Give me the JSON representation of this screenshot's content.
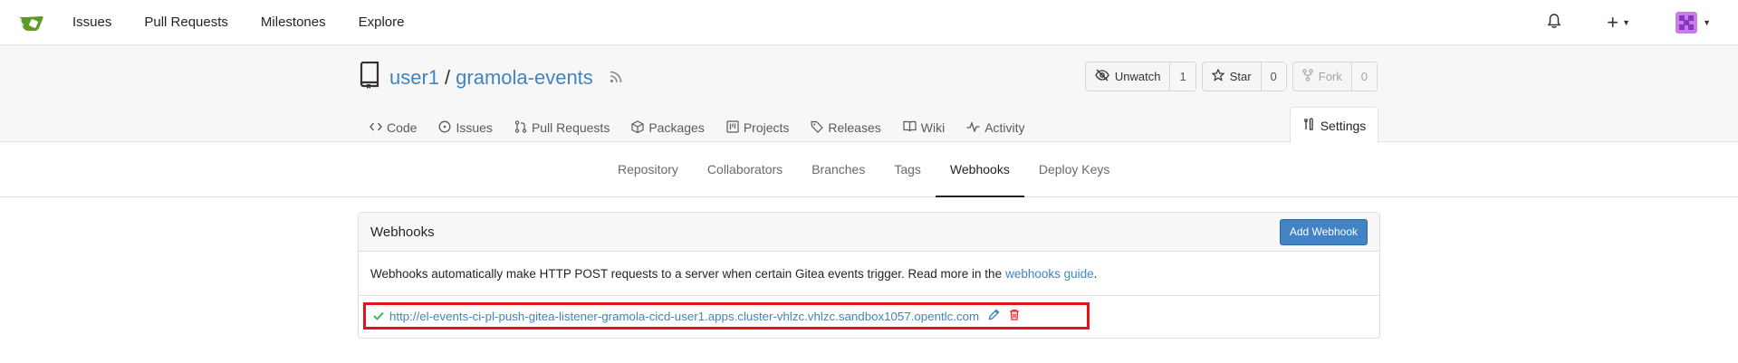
{
  "topnav": {
    "items": [
      "Issues",
      "Pull Requests",
      "Milestones",
      "Explore"
    ]
  },
  "repo": {
    "owner": "user1",
    "separator": "/",
    "name": "gramola-events",
    "buttons": {
      "unwatch_label": "Unwatch",
      "unwatch_count": "1",
      "star_label": "Star",
      "star_count": "0",
      "fork_label": "Fork",
      "fork_count": "0"
    },
    "tabs": [
      "Code",
      "Issues",
      "Pull Requests",
      "Packages",
      "Projects",
      "Releases",
      "Wiki",
      "Activity"
    ],
    "settings_label": "Settings"
  },
  "subtabs": [
    "Repository",
    "Collaborators",
    "Branches",
    "Tags",
    "Webhooks",
    "Deploy Keys"
  ],
  "active_subtab": "Webhooks",
  "webhooks": {
    "title": "Webhooks",
    "add_button": "Add Webhook",
    "description": "Webhooks automatically make HTTP POST requests to a server when certain Gitea events trigger. Read more in the",
    "guide_link": "webhooks guide",
    "guide_suffix": ".",
    "hooks": [
      {
        "url": "http://el-events-ci-pl-push-gitea-listener-gramola-cicd-user1.apps.cluster-vhlzc.vhlzc.sandbox1057.opentlc.com",
        "status": "success"
      }
    ]
  },
  "colors": {
    "accent": "#4183c4",
    "success": "#21ba45",
    "danger": "#db2828",
    "highlight_box": "#e3121b"
  },
  "icons": [
    "gitea-logo-icon",
    "bell-icon",
    "plus-icon",
    "repo-icon",
    "rss-icon",
    "eye-slash-icon",
    "star-icon",
    "fork-icon",
    "code-icon",
    "issue-icon",
    "pull-request-icon",
    "package-icon",
    "project-icon",
    "tag-icon",
    "book-icon",
    "pulse-icon",
    "tools-icon",
    "check-icon",
    "pencil-icon",
    "trash-icon"
  ]
}
